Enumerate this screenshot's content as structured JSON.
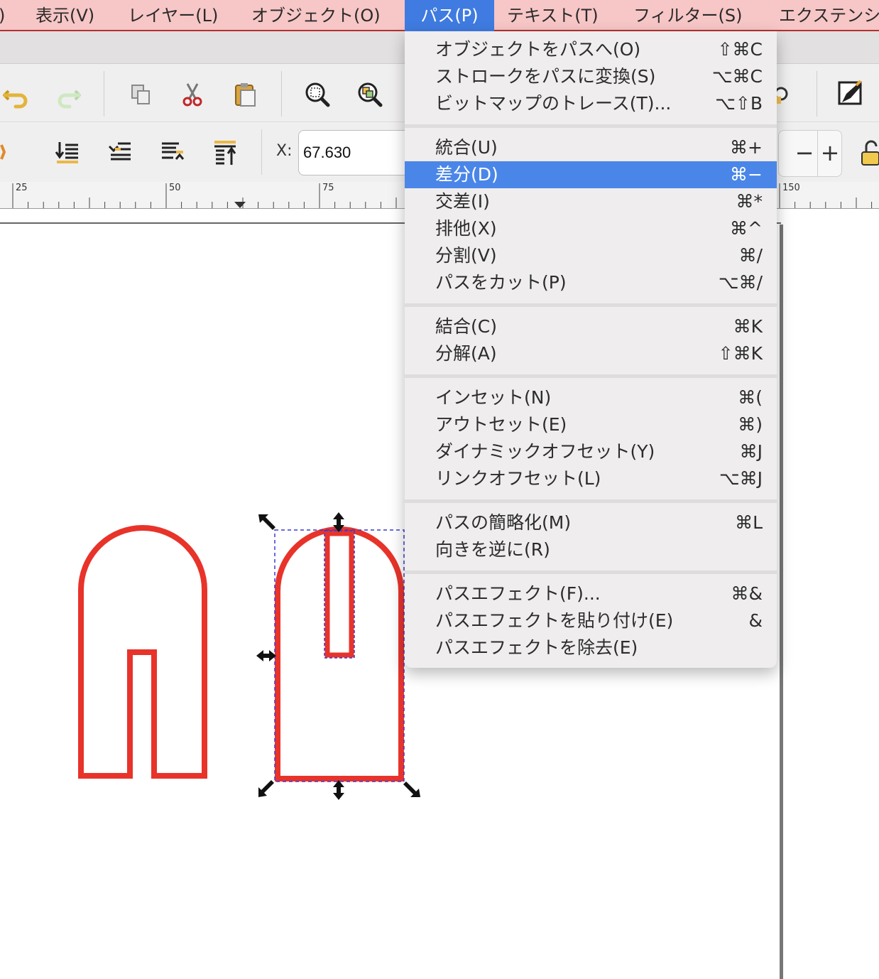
{
  "menubar": {
    "items": [
      {
        "label": ")"
      },
      {
        "label": "表示(V)"
      },
      {
        "label": "レイヤー(L)"
      },
      {
        "label": "オブジェクト(O)"
      },
      {
        "label": "パス(P)"
      },
      {
        "label": "テキスト(T)"
      },
      {
        "label": "フィルター(S)"
      },
      {
        "label": "エクステンシ"
      }
    ]
  },
  "toolbar": {
    "icons": [
      "undo-icon",
      "redo-icon",
      "duplicate-icon",
      "cut-icon",
      "paste-icon",
      "zoom-selection-icon",
      "zoom-drawing-icon",
      "inspect-icon",
      "pen-icon"
    ]
  },
  "toolctl": {
    "x_label": "X:",
    "x_value": "67.630",
    "minus": "−",
    "plus": "+"
  },
  "ruler": {
    "labels": [
      "25",
      "50",
      "75",
      "150"
    ]
  },
  "path_menu": {
    "items": [
      {
        "label": "オブジェクトをパスへ(O)",
        "shortcut": "⇧⌘C"
      },
      {
        "label": "ストロークをパスに変換(S)",
        "shortcut": "⌥⌘C"
      },
      {
        "label": "ビットマップのトレース(T)...",
        "shortcut": "⌥⇧B"
      },
      {
        "label": "統合(U)",
        "shortcut": "⌘+"
      },
      {
        "label": "差分(D)",
        "shortcut": "⌘−"
      },
      {
        "label": "交差(I)",
        "shortcut": "⌘*"
      },
      {
        "label": "排他(X)",
        "shortcut": "⌘^"
      },
      {
        "label": "分割(V)",
        "shortcut": "⌘/"
      },
      {
        "label": "パスをカット(P)",
        "shortcut": "⌥⌘/"
      },
      {
        "label": "結合(C)",
        "shortcut": "⌘K"
      },
      {
        "label": "分解(A)",
        "shortcut": "⇧⌘K"
      },
      {
        "label": "インセット(N)",
        "shortcut": "⌘("
      },
      {
        "label": "アウトセット(E)",
        "shortcut": "⌘)"
      },
      {
        "label": "ダイナミックオフセット(Y)",
        "shortcut": "⌘J"
      },
      {
        "label": "リンクオフセット(L)",
        "shortcut": "⌥⌘J"
      },
      {
        "label": "パスの簡略化(M)",
        "shortcut": "⌘L"
      },
      {
        "label": "向きを逆に(R)",
        "shortcut": ""
      },
      {
        "label": "パスエフェクト(F)...",
        "shortcut": "⌘&"
      },
      {
        "label": "パスエフェクトを貼り付け(E)",
        "shortcut": "&"
      },
      {
        "label": "パスエフェクトを除去(E)",
        "shortcut": ""
      }
    ],
    "highlighted": "差分(D)"
  },
  "colors": {
    "menubar_bg": "#f7c6c6",
    "menu_active": "#3f7be0",
    "menu_highlight": "#4a86e8",
    "shape_stroke": "#e8332a",
    "selection_dash": "#3a3ad0"
  }
}
